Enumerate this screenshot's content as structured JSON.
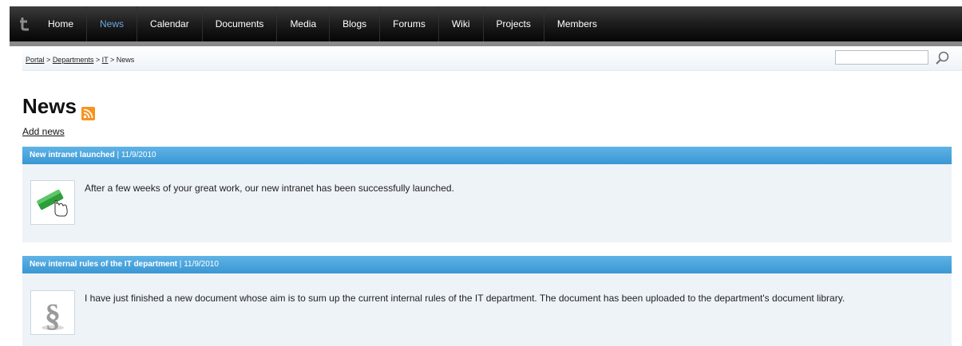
{
  "nav": {
    "items": [
      "Home",
      "News",
      "Calendar",
      "Documents",
      "Media",
      "Blogs",
      "Forums",
      "Wiki",
      "Projects",
      "Members"
    ],
    "active": "News"
  },
  "breadcrumb": {
    "links": [
      "Portal",
      "Departments",
      "IT"
    ],
    "separator": ">",
    "current": "News"
  },
  "search": {
    "value": "",
    "placeholder": ""
  },
  "page": {
    "title": "News",
    "add_news_label": "Add news"
  },
  "news": [
    {
      "title": "New intranet launched",
      "date": "11/9/2010",
      "text": "After a few weeks of your great work, our new intranet has been successfully launched.",
      "thumb_icon": "start-button-icon"
    },
    {
      "title": "New internal rules of the IT department",
      "date": "11/9/2010",
      "text": "I have just finished a new document whose aim is to sum up the current internal rules of the IT department. The document has been uploaded to the department's document library.",
      "thumb_icon": "section-sign-icon"
    }
  ],
  "colors": {
    "nav_active": "#6aa8e0",
    "news_header": "#3a97d3",
    "news_body": "#eef3f8",
    "rss": "#f7931e"
  }
}
